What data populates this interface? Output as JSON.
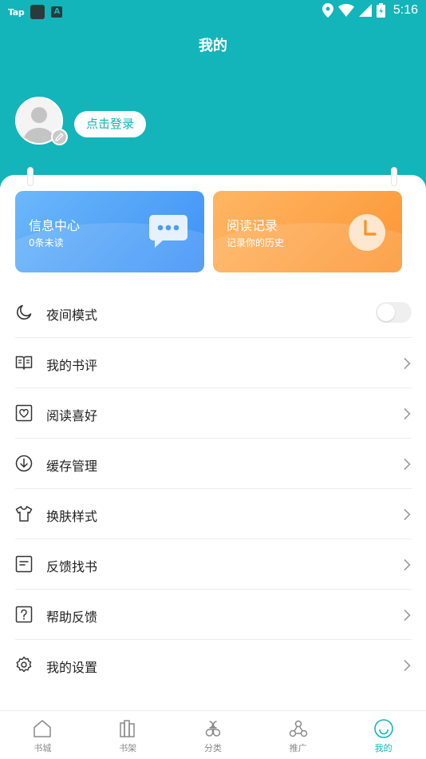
{
  "status_bar": {
    "carrier": "Tap",
    "badge_letter": "A",
    "time": "5:16"
  },
  "header": {
    "title": "我的",
    "login_label": "点击登录"
  },
  "cards": [
    {
      "title": "信息中心",
      "subtitle": "0条未读",
      "icon": "chat-bubble-icon"
    },
    {
      "title": "阅读记录",
      "subtitle": "记录你的历史",
      "icon": "clock-icon"
    }
  ],
  "menu": [
    {
      "label": "夜间模式",
      "icon": "moon-icon",
      "control": "toggle",
      "toggle_on": false
    },
    {
      "label": "我的书评",
      "icon": "book-review-icon",
      "control": "chevron"
    },
    {
      "label": "阅读喜好",
      "icon": "heart-frame-icon",
      "control": "chevron"
    },
    {
      "label": "缓存管理",
      "icon": "download-circle-icon",
      "control": "chevron"
    },
    {
      "label": "换肤样式",
      "icon": "shirt-icon",
      "control": "chevron"
    },
    {
      "label": "反馈找书",
      "icon": "note-icon",
      "control": "chevron"
    },
    {
      "label": "帮助反馈",
      "icon": "question-icon",
      "control": "chevron"
    },
    {
      "label": "我的设置",
      "icon": "gear-icon",
      "control": "chevron"
    }
  ],
  "tabs": [
    {
      "label": "书城",
      "icon": "home-icon",
      "active": false
    },
    {
      "label": "书架",
      "icon": "bookshelf-icon",
      "active": false
    },
    {
      "label": "分类",
      "icon": "category-icon",
      "active": false
    },
    {
      "label": "推广",
      "icon": "share-icon",
      "active": false
    },
    {
      "label": "我的",
      "icon": "smile-icon",
      "active": true
    }
  ],
  "colors": {
    "accent": "#13b5ba",
    "card_blue": "#4a9cf6",
    "card_orange": "#fca040",
    "icon_gray": "#333333",
    "tab_gray": "#8a8a8a"
  }
}
